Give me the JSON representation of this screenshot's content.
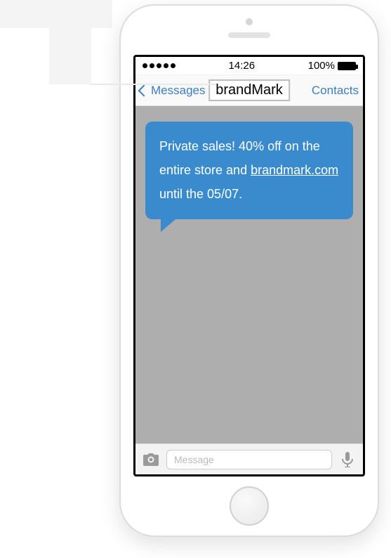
{
  "status": {
    "time": "14:26",
    "battery_text": "100%"
  },
  "nav": {
    "back_label": "Messages",
    "title": "brandMark",
    "right_label": "Contacts"
  },
  "message": {
    "text_before": "Private sales! 40% off on the entire store and ",
    "link_text": "brandmark.com",
    "text_after": " until the 05/07."
  },
  "input": {
    "placeholder": "Message"
  }
}
